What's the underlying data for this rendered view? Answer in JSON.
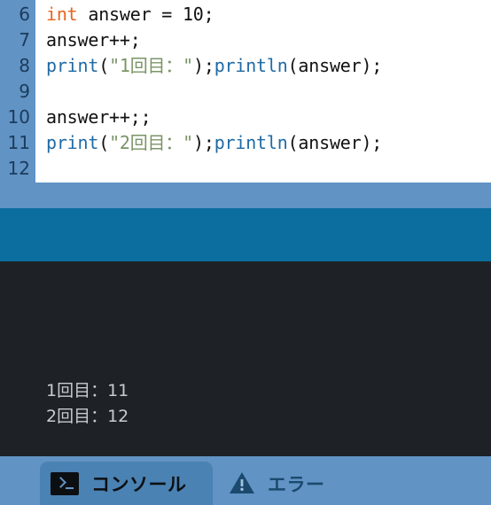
{
  "editor": {
    "line_numbers": [
      "6",
      "7",
      "8",
      "9",
      "10",
      "11",
      "12"
    ],
    "lines": [
      {
        "number": "6",
        "text": "int answer = 10;",
        "tokens": [
          {
            "t": "int",
            "k": "kw"
          },
          {
            "t": " answer = 10;",
            "k": "pl"
          }
        ]
      },
      {
        "number": "7",
        "text": "answer++;",
        "tokens": [
          {
            "t": "answer++;",
            "k": "pl"
          }
        ]
      },
      {
        "number": "8",
        "text": "print(\"1回目：\");println(answer);",
        "tokens": [
          {
            "t": "print",
            "k": "fn"
          },
          {
            "t": "(",
            "k": "pl"
          },
          {
            "t": "\"1回目：\"",
            "k": "str"
          },
          {
            "t": ");",
            "k": "pl"
          },
          {
            "t": "println",
            "k": "fn"
          },
          {
            "t": "(answer);",
            "k": "pl"
          }
        ]
      },
      {
        "number": "9",
        "text": "",
        "tokens": []
      },
      {
        "number": "10",
        "text": "answer++;;",
        "tokens": [
          {
            "t": "answer++;;",
            "k": "pl"
          }
        ]
      },
      {
        "number": "11",
        "text": "print(\"2回目：\");println(answer);",
        "tokens": [
          {
            "t": "print",
            "k": "fn"
          },
          {
            "t": "(",
            "k": "pl"
          },
          {
            "t": "\"2回目：\"",
            "k": "str"
          },
          {
            "t": ");",
            "k": "pl"
          },
          {
            "t": "println",
            "k": "fn"
          },
          {
            "t": "(answer);",
            "k": "pl"
          }
        ]
      },
      {
        "number": "12",
        "text": "",
        "tokens": []
      }
    ]
  },
  "console": {
    "output_lines": [
      "1回目：11",
      "2回目：12"
    ]
  },
  "tabs": [
    {
      "id": "console",
      "label": "コンソール",
      "icon": "terminal-icon",
      "active": true
    },
    {
      "id": "error",
      "label": "エラー",
      "icon": "warning-triangle-icon",
      "active": false
    }
  ],
  "colors": {
    "editor_background": "#ffffff",
    "gutter_background": "#6193c4",
    "gutter_text": "#1b3b5c",
    "keyword": "#e8641f",
    "function": "#1f6aa5",
    "string": "#7a9466",
    "plain": "#111111",
    "band_light_blue": "#6193c4",
    "band_teal": "#0b6e9e",
    "console_background": "#1e2227",
    "console_text": "#c8ccd0",
    "tabbar_background": "#6193c4",
    "tab_active_background": "#4a82b3",
    "tab_active_text": "#0c0f12",
    "tab_inactive_text": "#1b4a6e"
  }
}
